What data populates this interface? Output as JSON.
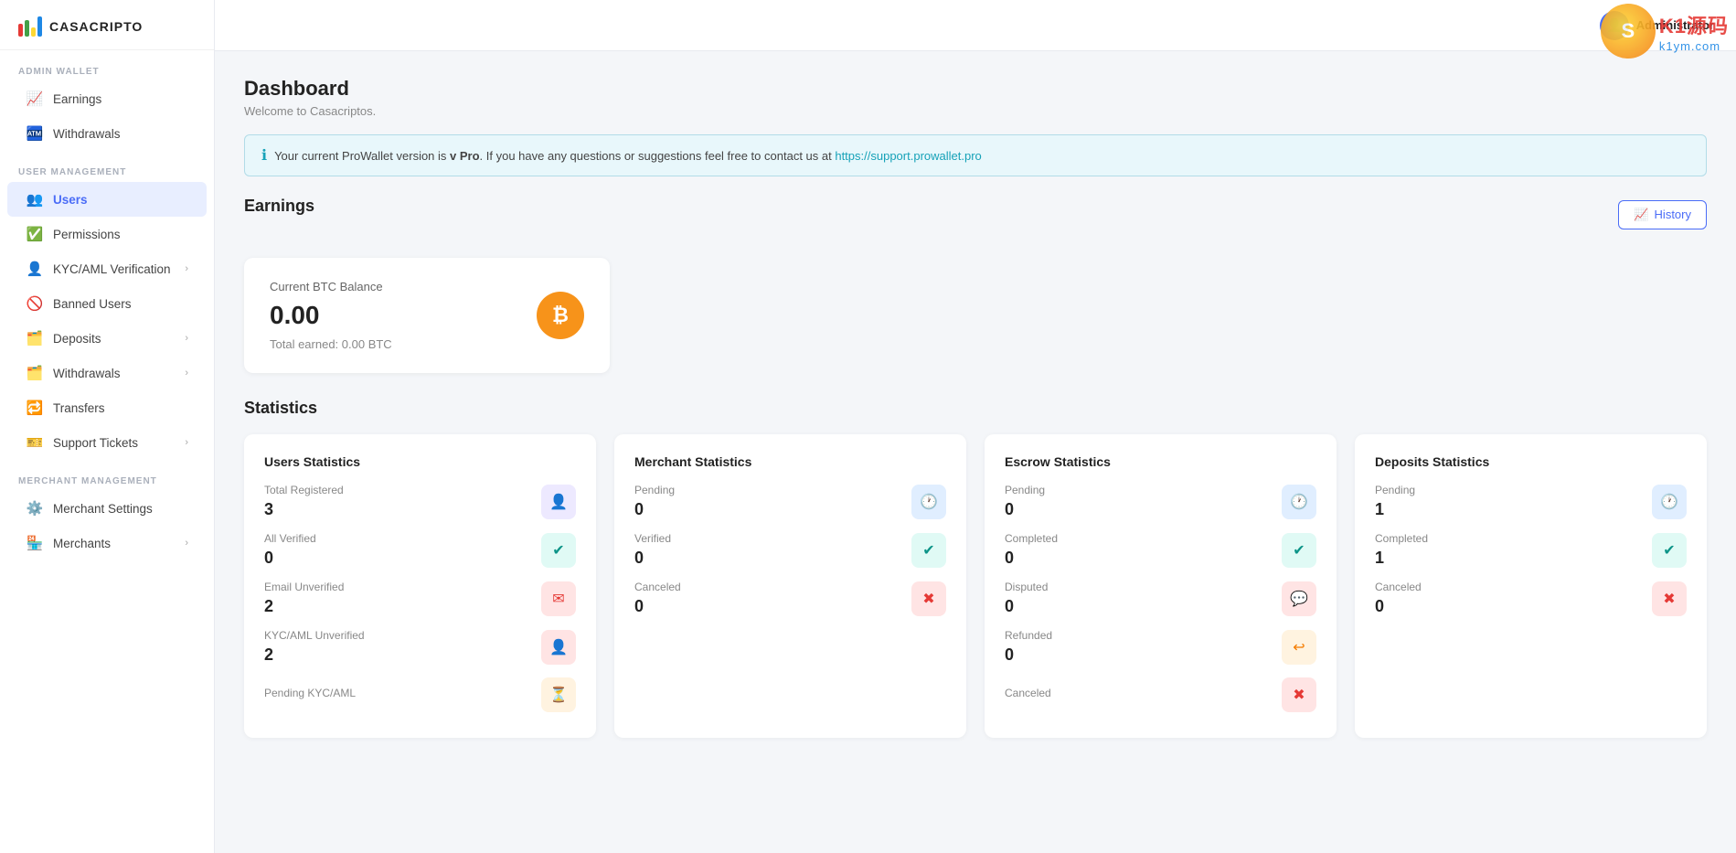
{
  "sidebar": {
    "logo_text": "CASACRIPTO",
    "sections": [
      {
        "label": "Admin Wallet",
        "items": [
          {
            "id": "earnings",
            "label": "Earnings",
            "icon": "📈",
            "hasChevron": false
          },
          {
            "id": "withdrawals",
            "label": "Withdrawals",
            "icon": "🏧",
            "hasChevron": false
          }
        ]
      },
      {
        "label": "User Management",
        "items": [
          {
            "id": "users",
            "label": "Users",
            "icon": "👥",
            "hasChevron": false
          },
          {
            "id": "permissions",
            "label": "Permissions",
            "icon": "✅",
            "hasChevron": false
          },
          {
            "id": "kyc-aml",
            "label": "KYC/AML Verification",
            "icon": "👤",
            "hasChevron": true
          },
          {
            "id": "banned-users",
            "label": "Banned Users",
            "icon": "🚫",
            "hasChevron": false
          },
          {
            "id": "deposits",
            "label": "Deposits",
            "icon": "🗂️",
            "hasChevron": true
          },
          {
            "id": "withdrawals-user",
            "label": "Withdrawals",
            "icon": "🗂️",
            "hasChevron": true
          },
          {
            "id": "transfers",
            "label": "Transfers",
            "icon": "🔁",
            "hasChevron": false
          },
          {
            "id": "support-tickets",
            "label": "Support Tickets",
            "icon": "🎫",
            "hasChevron": true
          }
        ]
      },
      {
        "label": "Merchant Management",
        "items": [
          {
            "id": "merchant-settings",
            "label": "Merchant Settings",
            "icon": "⚙️",
            "hasChevron": false
          },
          {
            "id": "merchants",
            "label": "Merchants",
            "icon": "🏪",
            "hasChevron": true
          }
        ]
      }
    ]
  },
  "topbar": {
    "username": "Administrator"
  },
  "page": {
    "title": "Dashboard",
    "subtitle": "Welcome to Casacriptos."
  },
  "info_banner": {
    "text": "Your current ProWallet version is v Pro. If you have any questions or suggestions feel free to contact us at",
    "link_text": "https://support.prowallet.pro",
    "link_url": "https://support.prowallet.pro"
  },
  "earnings": {
    "section_title": "Earnings",
    "history_btn_label": "History",
    "balance_label": "Current BTC Balance",
    "balance_value": "0.00",
    "total_earned_label": "Total earned: 0.00 BTC"
  },
  "statistics": {
    "section_title": "Statistics",
    "cards": [
      {
        "title": "Users Statistics",
        "rows": [
          {
            "label": "Total Registered",
            "value": "3",
            "icon_type": "purple",
            "icon": "👤"
          },
          {
            "label": "All Verified",
            "value": "0",
            "icon_type": "teal",
            "icon": "✔"
          },
          {
            "label": "Email Unverified",
            "value": "2",
            "icon_type": "red",
            "icon": "✉"
          },
          {
            "label": "KYC/AML Unverified",
            "value": "2",
            "icon_type": "red",
            "icon": "👤"
          },
          {
            "label": "Pending KYC/AML",
            "value": "",
            "icon_type": "orange",
            "icon": "⏳"
          }
        ]
      },
      {
        "title": "Merchant Statistics",
        "rows": [
          {
            "label": "Pending",
            "value": "0",
            "icon_type": "blue",
            "icon": "🕐"
          },
          {
            "label": "Verified",
            "value": "0",
            "icon_type": "teal",
            "icon": "✔"
          },
          {
            "label": "Canceled",
            "value": "0",
            "icon_type": "red",
            "icon": "✖"
          }
        ]
      },
      {
        "title": "Escrow Statistics",
        "rows": [
          {
            "label": "Pending",
            "value": "0",
            "icon_type": "blue",
            "icon": "🕐"
          },
          {
            "label": "Completed",
            "value": "0",
            "icon_type": "teal",
            "icon": "✔"
          },
          {
            "label": "Disputed",
            "value": "0",
            "icon_type": "red",
            "icon": "💬"
          },
          {
            "label": "Refunded",
            "value": "0",
            "icon_type": "orange",
            "icon": "↩"
          },
          {
            "label": "Canceled",
            "value": "",
            "icon_type": "red",
            "icon": "✖"
          }
        ]
      },
      {
        "title": "Deposits Statistics",
        "rows": [
          {
            "label": "Pending",
            "value": "1",
            "icon_type": "blue",
            "icon": "🕐"
          },
          {
            "label": "Completed",
            "value": "1",
            "icon_type": "teal",
            "icon": "✔"
          },
          {
            "label": "Canceled",
            "value": "0",
            "icon_type": "red",
            "icon": "✖"
          }
        ]
      }
    ]
  }
}
